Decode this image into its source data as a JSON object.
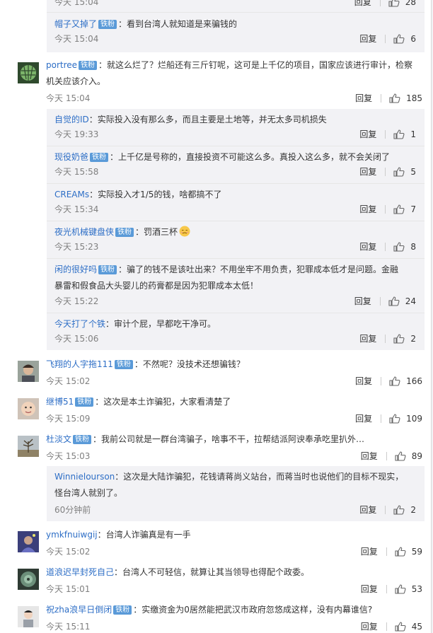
{
  "common": {
    "reply_label": "回复",
    "badge_label": "铁粉"
  },
  "first_sub": {
    "partial": {
      "time": "今天 15:04",
      "likes": "28"
    },
    "items": [
      {
        "user": "帽子又掉了",
        "text": "：看到台湾人就知道是来骗钱的",
        "time": "今天 15:04",
        "likes": "6",
        "badge": true
      }
    ]
  },
  "threads": [
    {
      "user": "portree",
      "badge": true,
      "text_line1": "：就这么烂了？烂船还有三斤钉呢，这可是上千亿的项目，国家应该进行审计，检察",
      "text_line2": "机关应该介入。",
      "time": "今天 15:04",
      "likes": "185",
      "replies": [
        {
          "user": "自觉的ID",
          "badge": false,
          "text": "：实际投入没有那么多，而且主要是土地等，并无太多司机损失",
          "time": "今天 19:33",
          "likes": "1"
        },
        {
          "user": "现役奶爸",
          "badge": true,
          "text": "：上千亿是号称的，直接投资不可能这么多。真投入这么多，就不会关闭了",
          "time": "今天 15:58",
          "likes": "5"
        },
        {
          "user": "CREAMs",
          "badge": false,
          "text": "：实际投入才1/5的钱，啥都搞不了",
          "time": "今天 15:34",
          "likes": "7"
        },
        {
          "user": "夜光机械键盘侠",
          "badge": true,
          "text": "：罚酒三杯",
          "emoji": true,
          "time": "今天 15:23",
          "likes": "8"
        },
        {
          "user": "闲的很好吗",
          "badge": true,
          "text_line1": "：骗了的钱不是该吐出来？不用坐牢不用负责，犯罪成本低才是问题。金融",
          "text_line2": "暴雷和假食品大头婴儿的药膏都是因为犯罪成本太低！",
          "time": "今天 15:22",
          "likes": "24"
        },
        {
          "user": "今天打了个铁",
          "badge": false,
          "text": "：审计个屁，早都吃干净可。",
          "time": "今天 15:06",
          "likes": "2"
        }
      ]
    },
    {
      "user": "飞翔的人字拖111",
      "badge": true,
      "text": "：不然呢？没技术还想骗钱？",
      "time": "今天 15:02",
      "likes": "166"
    },
    {
      "user": "继博51",
      "badge": true,
      "text": "：这次是本土诈骗犯，大家看清楚了",
      "time": "今天 15:09",
      "likes": "109"
    },
    {
      "user": "杜淡文",
      "badge": true,
      "text": "：我前公司就是一群台湾骗子，啥事不干，拉帮结派阿谀奉承吃里扒外…",
      "time": "今天 15:03",
      "likes": "89",
      "replies": [
        {
          "user": "Winnielourson",
          "badge": false,
          "text_line1": "：这次是大陆诈骗犯，花钱请蒋尚义站台，而蒋当时也说他们的目标不现实，",
          "text_line2": "怪台湾人就别了。",
          "time": "60分钟前",
          "likes": "2"
        }
      ]
    },
    {
      "user": "ymkfnuiwgij",
      "badge": false,
      "text": "：台湾人诈骗真是有一手",
      "time": "今天 15:02",
      "likes": "59"
    },
    {
      "user": "道浪迟早封死自己",
      "badge": false,
      "text": "：台湾人不可轻信，就算让其当领导也得配个政委。",
      "time": "今天 15:01",
      "likes": "53"
    },
    {
      "user": "祝zha浪早日倒闭",
      "badge": true,
      "text": "：实缴资金为0居然能把武汉市政府忽悠成这样，没有内幕谁信?",
      "time": "今天 15:11",
      "likes": "45"
    }
  ]
}
